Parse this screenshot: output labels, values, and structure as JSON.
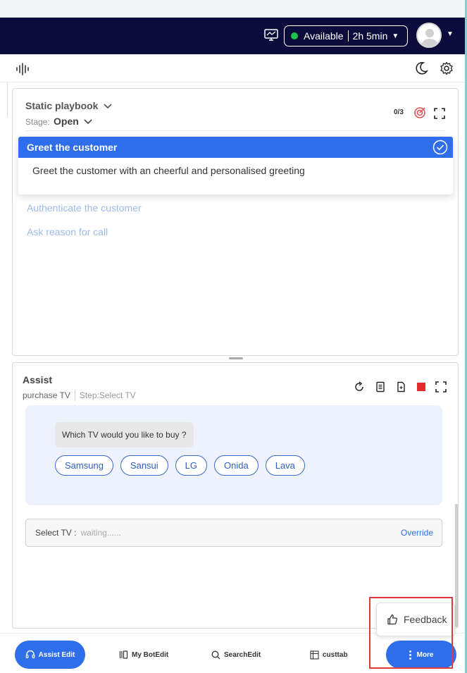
{
  "header": {
    "status_label": "Available",
    "status_timer": "2h 5min",
    "status_color": "#19c34a"
  },
  "playbook": {
    "title": "Static playbook",
    "stage_label": "Stage:",
    "stage_value": "Open",
    "progress": "0/3",
    "steps": [
      {
        "title": "Greet the customer",
        "description": "Greet the customer with an cheerful and personalised greeting"
      },
      {
        "title": "Authenticate the customer"
      },
      {
        "title": "Ask reason for call"
      }
    ]
  },
  "assist": {
    "title": "Assist",
    "flow_name": "purchase TV",
    "step_label": "Step:Select TV",
    "question": "Which TV would you like to buy ?",
    "options": [
      "Samsung",
      "Sansui",
      "LG",
      "Onida",
      "Lava"
    ],
    "field_label": "Select TV :",
    "field_value": "waiting......",
    "override_label": "Override"
  },
  "feedback_label": "Feedback",
  "bottom_nav": {
    "assist_edit": "Assist Edit",
    "my_botedit": "My BotEdit",
    "search_edit": "SearchEdit",
    "custtab": "custtab",
    "more": "More"
  },
  "colors": {
    "navbar": "#0c0c3c",
    "accent": "#2f6eea",
    "highlight": "#e03b3b"
  }
}
